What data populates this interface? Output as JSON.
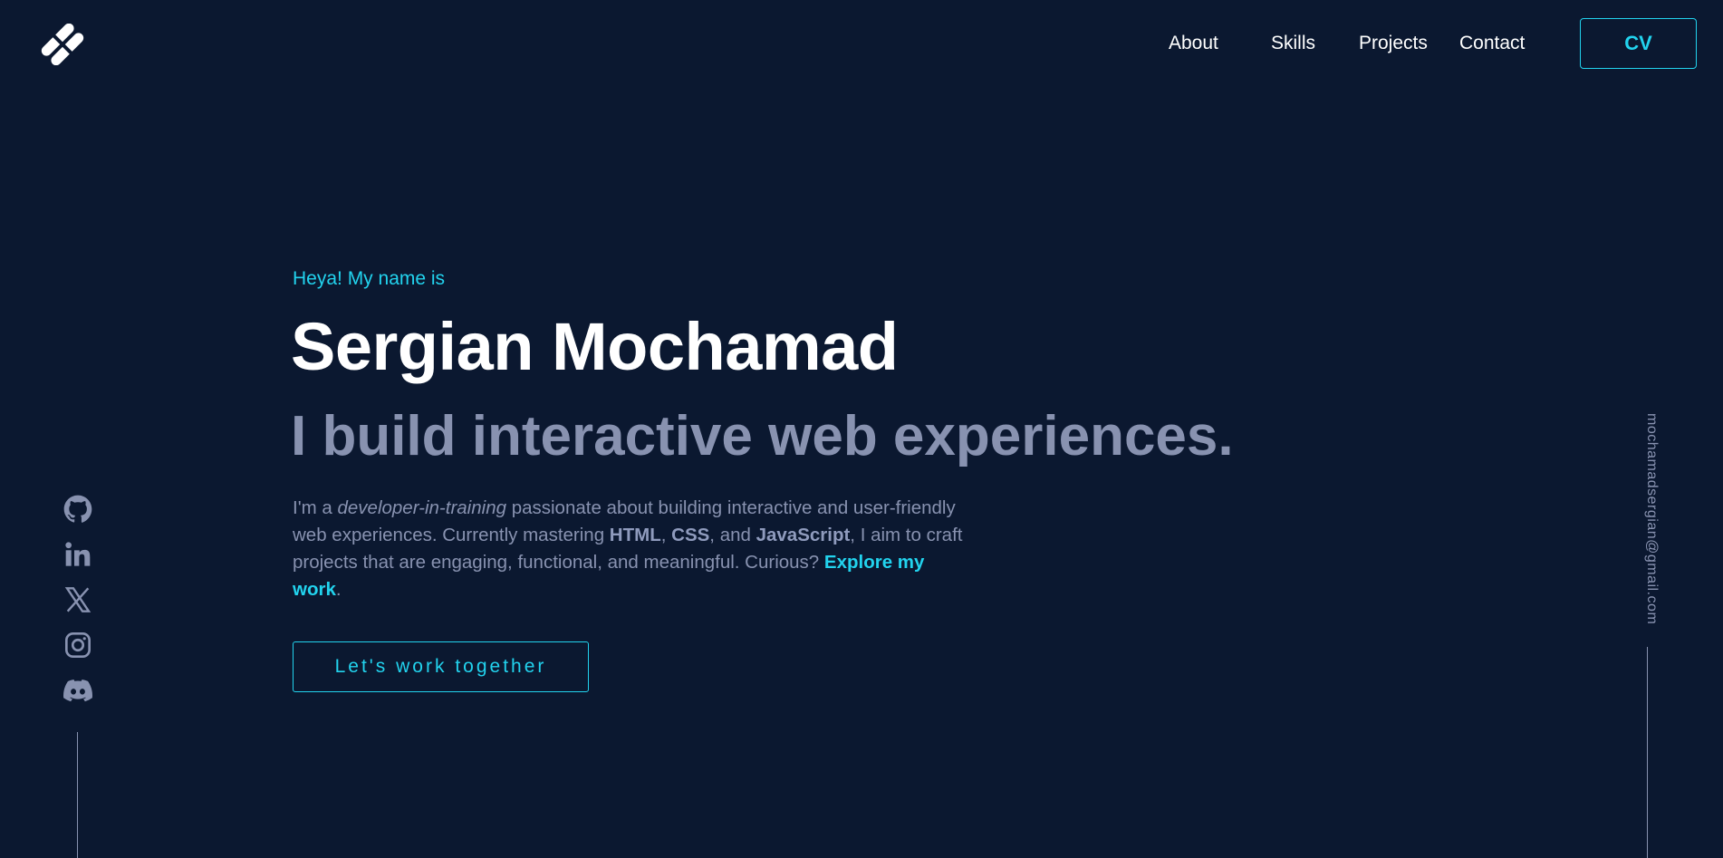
{
  "brand": {
    "logo_icon": "logo-icon"
  },
  "nav": {
    "items": [
      {
        "label": "About"
      },
      {
        "label": "Skills"
      },
      {
        "label": "Projects"
      },
      {
        "label": "Contact"
      }
    ],
    "cv_label": "CV"
  },
  "hero": {
    "greeting": "Heya! My name is",
    "name": "Sergian Mochamad",
    "tagline": "I build interactive web experiences.",
    "intro": {
      "p1": "I'm a ",
      "role": "developer-in-training",
      "p2": " passionate about building interactive and user-friendly web experiences. Currently mastering ",
      "html": "HTML",
      "sep1": ", ",
      "css": "CSS",
      "sep2": ", and ",
      "js": "JavaScript",
      "p3": ", I aim to craft projects that are engaging, functional, and meaningful. Curious? ",
      "explore": "Explore my work",
      "end": "."
    },
    "cta_label": "Let's work together"
  },
  "social": [
    {
      "icon": "github-icon"
    },
    {
      "icon": "linkedin-icon"
    },
    {
      "icon": "x-icon"
    },
    {
      "icon": "instagram-icon"
    },
    {
      "icon": "discord-icon"
    }
  ],
  "email": "mochamadsergian@gmail.com",
  "colors": {
    "background": "#0b1830",
    "accent": "#22d3ee",
    "muted": "#8892b0",
    "text": "#ffffff"
  }
}
